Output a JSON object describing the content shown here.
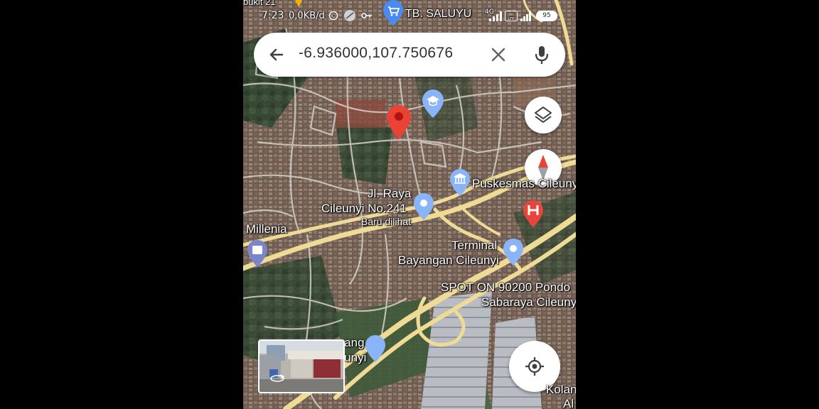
{
  "status_bar": {
    "time": "7:23",
    "speed": "0,0KB/d",
    "battery": "95",
    "network": "4G",
    "place_label": "TB. SALUYU",
    "top_left_label": "bukit 21"
  },
  "search": {
    "query": "-6.936000,107.750676"
  },
  "map_labels": {
    "puskesmas": "Puskesmas Cileunyi",
    "jl_raya_line1": "Jl. Raya",
    "jl_raya_line2": "Cileunyi No.241",
    "baru_dilihat": "Baru dilihat",
    "millenia": "Millenia",
    "terminal_line1": "Terminal",
    "terminal_line2": "Bayangan Cileunyi",
    "spot_line1": "SPOT ON 90200 Pondo",
    "spot_line2": "Sabaraya Cileuny",
    "bottom_label_line1": "...ang",
    "bottom_label_line2": "...unyi",
    "kolam_line1": "Kolan",
    "kolam_line2": "Al"
  },
  "icons": {
    "back": "arrow-left-icon",
    "clear": "close-icon",
    "mic": "microphone-icon",
    "layers": "layers-icon",
    "compass": "compass-icon",
    "my_location": "my-location-icon",
    "pin": "red-location-pin",
    "street_view": "rotate-360-icon"
  },
  "colors": {
    "pin": "#ea4335",
    "poi_blue": "#8ab4f8",
    "hospital": "#e8453c",
    "road_yellow": "#f3e2a0",
    "road_white": "#d9d6cf"
  }
}
